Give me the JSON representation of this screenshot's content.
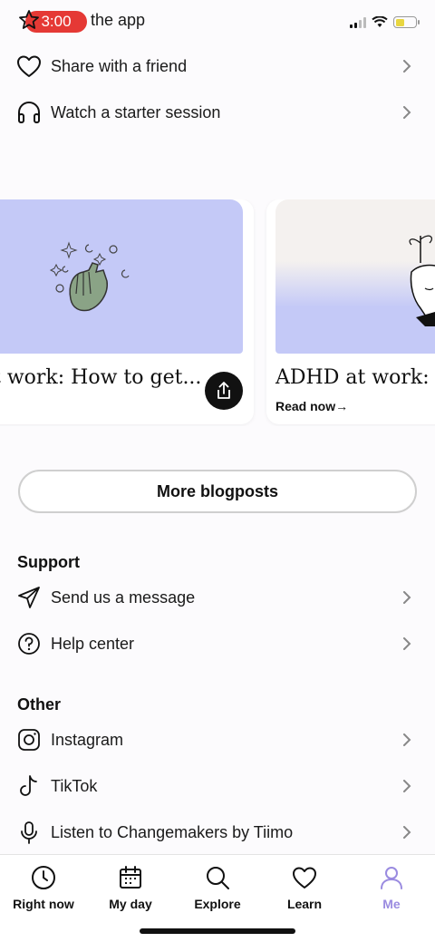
{
  "status_bar": {
    "time": "3:00",
    "battery_level": 0.45
  },
  "top_rows": [
    {
      "label": "the app",
      "icon": "star-icon"
    },
    {
      "label": "Share with a friend",
      "icon": "heart-icon"
    },
    {
      "label": "Watch a starter session",
      "icon": "headphones-icon"
    }
  ],
  "blog_cards": [
    {
      "title": "t work: How to get...",
      "illustration": "hand-with-sparkles-illustration",
      "action": "share-icon"
    },
    {
      "title": "ADHD at work: H",
      "cta": "Read now→",
      "illustration": "head-with-plant-illustration"
    }
  ],
  "more_blogposts_label": "More blogposts",
  "support": {
    "heading": "Support",
    "items": [
      {
        "label": "Send us a message",
        "icon": "paper-plane-icon"
      },
      {
        "label": "Help center",
        "icon": "question-circle-icon"
      }
    ]
  },
  "other": {
    "heading": "Other",
    "items": [
      {
        "label": "Instagram",
        "icon": "instagram-icon"
      },
      {
        "label": "TikTok",
        "icon": "tiktok-icon"
      },
      {
        "label": "Listen to Changemakers by Tiimo",
        "icon": "microphone-icon"
      }
    ]
  },
  "tabbar": {
    "items": [
      {
        "label": "Right now",
        "icon": "clock-icon"
      },
      {
        "label": "My day",
        "icon": "calendar-icon"
      },
      {
        "label": "Explore",
        "icon": "search-icon"
      },
      {
        "label": "Learn",
        "icon": "heart-icon"
      },
      {
        "label": "Me",
        "icon": "person-icon",
        "active": true
      }
    ]
  },
  "colors": {
    "accent": "#9a8be0",
    "card_blue": "#c4c9f7",
    "time_pill": "#e53935"
  }
}
